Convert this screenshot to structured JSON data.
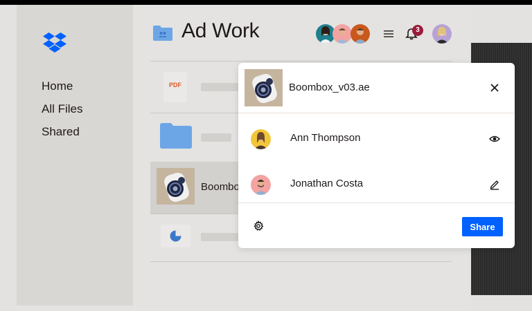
{
  "app": {
    "title": "Ad Work",
    "notification_count": "3",
    "accent_color": "#0061fe"
  },
  "sidebar": {
    "items": [
      {
        "label": "Home"
      },
      {
        "label": "All Files"
      },
      {
        "label": "Shared"
      }
    ]
  },
  "file_list": {
    "rows": [
      {
        "type": "pdf",
        "icon_text": "PDF"
      },
      {
        "type": "folder"
      },
      {
        "type": "video",
        "name": "Boombox"
      },
      {
        "type": "chart"
      }
    ]
  },
  "share_modal": {
    "file_name": "Boombox_v03.ae",
    "people": [
      {
        "name": "Ann Thompson",
        "permission_icon": "eye-icon"
      },
      {
        "name": "Jonathan Costa",
        "permission_icon": "pencil-icon"
      }
    ],
    "share_label": "Share"
  }
}
